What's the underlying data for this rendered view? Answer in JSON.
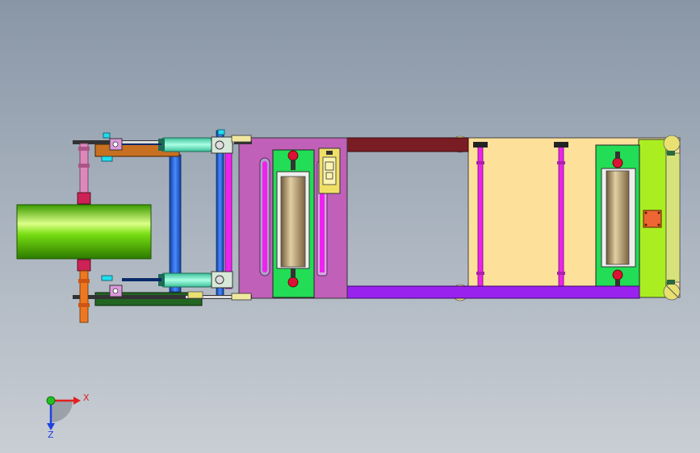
{
  "viewport": {
    "background_top": "#8996a6",
    "background_bottom": "#c9ced4"
  },
  "triad": {
    "x_label": "X",
    "z_label": "Z",
    "x_color": "#e02020",
    "y_color": "#20c020",
    "z_color": "#2040e0"
  },
  "colors": {
    "roll_green": "#66dd11",
    "frame_tan": "#fde09a",
    "plate_mauve": "#c060b8",
    "rail_purple": "#9a22ee",
    "rail_maroon": "#7a1c24",
    "bracket_green": "#22dd55",
    "roller_bronze": "#b89a66",
    "rod_magenta": "#ee22ee",
    "rod_blue": "#2266dd",
    "cylinder_teal": "#77eecc",
    "end_plate_lime": "#aaee22",
    "knob_red": "#dd1133",
    "block_orange": "#ee6633",
    "arm_brown": "#c87022",
    "arm_darkgreen": "#226622",
    "shaft_pink": "#dd88bb",
    "shaft_orange": "#ee7722",
    "clip_cyan": "#22ddee"
  }
}
